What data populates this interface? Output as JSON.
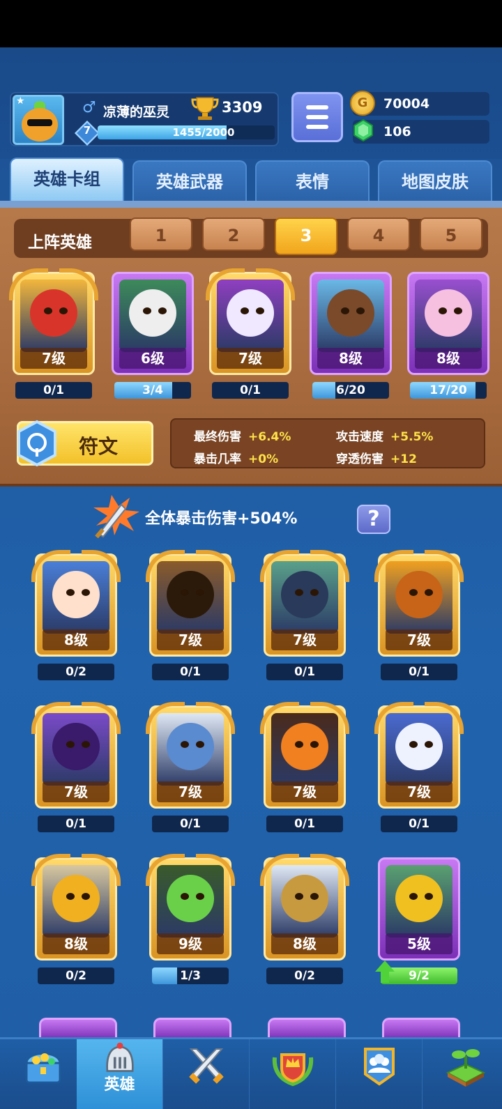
{
  "header": {
    "player_name": "凉薄的巫灵",
    "gender_symbol": "♂",
    "player_level": "7",
    "xp_text": "1455/2000",
    "xp_progress": 0.7275,
    "trophies": "3309",
    "coins": "70004",
    "gems": "106"
  },
  "tabs": [
    {
      "label": "英雄卡组",
      "active": true
    },
    {
      "label": "英雄武器",
      "active": false
    },
    {
      "label": "表情",
      "active": false
    },
    {
      "label": "地图皮肤",
      "active": false
    }
  ],
  "team": {
    "label": "上阵英雄",
    "slots": [
      "1",
      "2",
      "3",
      "4",
      "5"
    ],
    "active_slot": "3",
    "heroes": [
      {
        "level": "7级",
        "progress": "0/1",
        "fill": 0.0,
        "rarity": "gold"
      },
      {
        "level": "6级",
        "progress": "3/4",
        "fill": 0.75,
        "rarity": "purple"
      },
      {
        "level": "7级",
        "progress": "0/1",
        "fill": 0.0,
        "rarity": "gold"
      },
      {
        "level": "8级",
        "progress": "6/20",
        "fill": 0.3,
        "rarity": "purple"
      },
      {
        "level": "8级",
        "progress": "17/20",
        "fill": 0.85,
        "rarity": "purple"
      }
    ]
  },
  "rune": {
    "label": "符文",
    "stats": [
      {
        "name": "最终伤害",
        "value": "+6.4%"
      },
      {
        "name": "攻击速度",
        "value": "+5.5%"
      },
      {
        "name": "暴击几率",
        "value": "+0%"
      },
      {
        "name": "穿透伤害",
        "value": "+12"
      }
    ]
  },
  "collection": {
    "crit_bonus": "全体暴击伤害+504%",
    "help_label": "?",
    "heroes": [
      {
        "level": "8级",
        "progress": "0/2",
        "fill": 0.0,
        "rarity": "gold"
      },
      {
        "level": "7级",
        "progress": "0/1",
        "fill": 0.0,
        "rarity": "gold"
      },
      {
        "level": "7级",
        "progress": "0/1",
        "fill": 0.0,
        "rarity": "gold"
      },
      {
        "level": "7级",
        "progress": "0/1",
        "fill": 0.0,
        "rarity": "gold"
      },
      {
        "level": "7级",
        "progress": "0/1",
        "fill": 0.0,
        "rarity": "gold"
      },
      {
        "level": "7级",
        "progress": "0/1",
        "fill": 0.0,
        "rarity": "gold"
      },
      {
        "level": "7级",
        "progress": "0/1",
        "fill": 0.0,
        "rarity": "gold"
      },
      {
        "level": "7级",
        "progress": "0/1",
        "fill": 0.0,
        "rarity": "gold"
      },
      {
        "level": "8级",
        "progress": "0/2",
        "fill": 0.0,
        "rarity": "gold"
      },
      {
        "level": "9级",
        "progress": "1/3",
        "fill": 0.33,
        "rarity": "gold"
      },
      {
        "level": "8级",
        "progress": "0/2",
        "fill": 0.0,
        "rarity": "gold"
      },
      {
        "level": "5级",
        "progress": "9/2",
        "fill": 1.0,
        "rarity": "purple",
        "upgradable": true
      }
    ]
  },
  "bottom_nav": [
    {
      "icon": "treasure-chest-icon",
      "label": "",
      "active": false
    },
    {
      "icon": "knight-helmet-icon",
      "label": "英雄",
      "active": true
    },
    {
      "icon": "crossed-swords-icon",
      "label": "",
      "active": false
    },
    {
      "icon": "crown-shield-icon",
      "label": "",
      "active": false
    },
    {
      "icon": "team-banner-icon",
      "label": "",
      "active": false
    },
    {
      "icon": "sprout-island-icon",
      "label": "",
      "active": false
    }
  ],
  "colors": {
    "background": "#1f5ea6",
    "panel_wood": "#9c6036",
    "accent_gold": "#f3c12a",
    "stat_value": "#ffe24a"
  }
}
